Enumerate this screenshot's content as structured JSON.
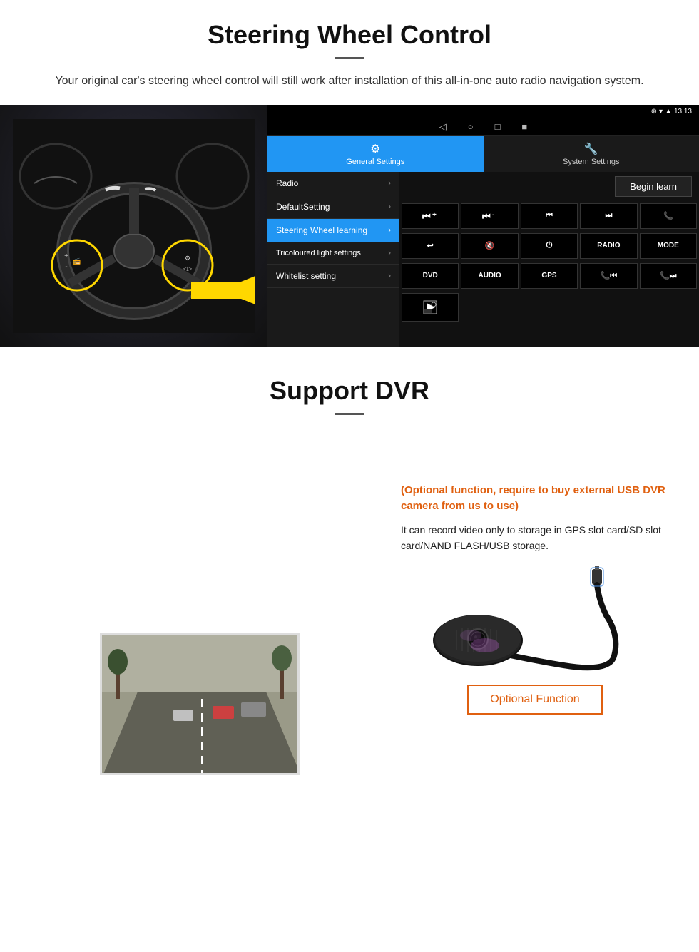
{
  "header": {
    "title": "Steering Wheel Control",
    "subtitle": "Your original car's steering wheel control will still work after installation of this all-in-one auto radio navigation system."
  },
  "android_ui": {
    "status_bar": {
      "time": "13:13",
      "icons": [
        "wifi",
        "signal",
        "battery"
      ]
    },
    "nav_icons": [
      "◁",
      "○",
      "□",
      "■"
    ],
    "tabs": [
      {
        "label": "General Settings",
        "active": true
      },
      {
        "label": "System Settings",
        "active": false
      }
    ],
    "menu_items": [
      {
        "label": "Radio",
        "active": false
      },
      {
        "label": "DefaultSetting",
        "active": false
      },
      {
        "label": "Steering Wheel learning",
        "active": true
      },
      {
        "label": "Tricoloured light settings",
        "active": false
      },
      {
        "label": "Whitelist setting",
        "active": false
      }
    ],
    "begin_learn_label": "Begin learn",
    "control_buttons": [
      {
        "label": "⏮+",
        "row": 1
      },
      {
        "label": "⏮-",
        "row": 1
      },
      {
        "label": "⏮⏮",
        "row": 1
      },
      {
        "label": "⏭⏭",
        "row": 1
      },
      {
        "label": "📞",
        "row": 1
      },
      {
        "label": "↩",
        "row": 2
      },
      {
        "label": "🔇",
        "row": 2
      },
      {
        "label": "⏻",
        "row": 2
      },
      {
        "label": "RADIO",
        "row": 2
      },
      {
        "label": "MODE",
        "row": 2
      },
      {
        "label": "DVD",
        "row": 3
      },
      {
        "label": "AUDIO",
        "row": 3
      },
      {
        "label": "GPS",
        "row": 3
      },
      {
        "label": "📞⏮⏮",
        "row": 3
      },
      {
        "label": "⏭⏭+",
        "row": 3
      },
      {
        "label": "⏺",
        "row": 4
      }
    ]
  },
  "dvr_section": {
    "title": "Support DVR",
    "optional_note": "(Optional function, require to buy external USB DVR camera from us to use)",
    "description": "It can record video only to storage in GPS slot card/SD slot card/NAND FLASH/USB storage.",
    "optional_button_label": "Optional Function"
  }
}
